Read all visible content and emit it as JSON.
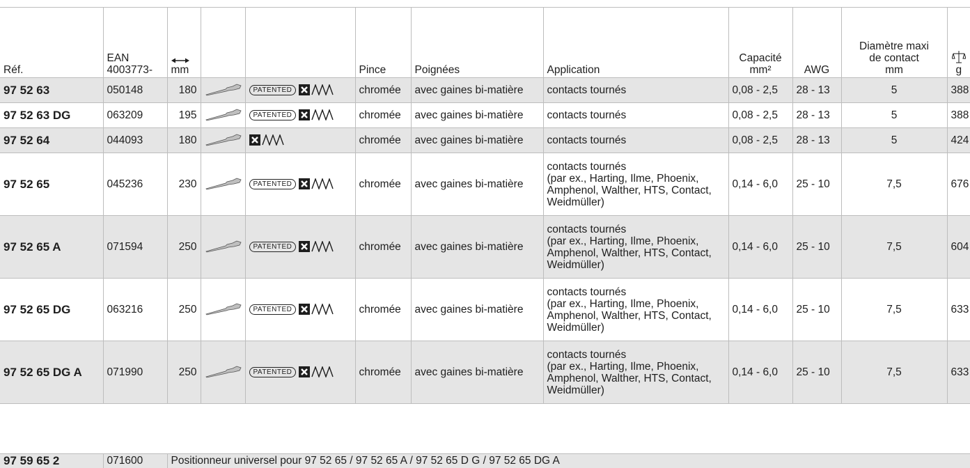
{
  "header": {
    "ref": "Réf.",
    "ean_line1": "EAN",
    "ean_line2": "4003773-",
    "length_unit": "mm",
    "pince": "Pince",
    "poignees": "Poignées",
    "application": "Application",
    "capacite_line1": "Capacité",
    "capacite_line2": "mm²",
    "awg": "AWG",
    "diam_line1": "Diamètre maxi",
    "diam_line2": "de contact",
    "diam_line3": "mm",
    "weight_unit": "g",
    "length_icon": "double-arrow-icon",
    "weight_icon": "scale-icon"
  },
  "patented_label": "PATENTED",
  "rows": [
    {
      "ref": "97 52 63",
      "ean": "050148",
      "length": "180",
      "patented": true,
      "pince": "chromée",
      "poignees": "avec gaines bi-matière",
      "app": "contacts tournés",
      "app_detail": "",
      "capacite": "0,08 - 2,5",
      "awg": "28 - 13",
      "diam": "5",
      "weight": "388"
    },
    {
      "ref": "97 52 63 DG",
      "ean": "063209",
      "length": "195",
      "patented": true,
      "pince": "chromée",
      "poignees": "avec gaines bi-matière",
      "app": "contacts tournés",
      "app_detail": "",
      "capacite": "0,08 - 2,5",
      "awg": "28 - 13",
      "diam": "5",
      "weight": "388"
    },
    {
      "ref": "97 52 64",
      "ean": "044093",
      "length": "180",
      "patented": false,
      "pince": "chromée",
      "poignees": "avec gaines bi-matière",
      "app": "contacts tournés",
      "app_detail": "",
      "capacite": "0,08 - 2,5",
      "awg": "28 - 13",
      "diam": "5",
      "weight": "424"
    },
    {
      "ref": "97 52 65",
      "ean": "045236",
      "length": "230",
      "patented": true,
      "pince": "chromée",
      "poignees": "avec gaines bi-matière",
      "app": "contacts tournés",
      "app_detail": "(par ex., Harting, Ilme, Phoenix, Amphenol, Walther, HTS, Contact, Weidmüller)",
      "capacite": "0,14 - 6,0",
      "awg": "25 - 10",
      "diam": "7,5",
      "weight": "676"
    },
    {
      "ref": "97 52 65 A",
      "ean": "071594",
      "length": "250",
      "patented": true,
      "pince": "chromée",
      "poignees": "avec gaines bi-matière",
      "app": "contacts tournés",
      "app_detail": "(par ex., Harting, Ilme, Phoenix, Amphenol, Walther, HTS, Contact, Weidmüller)",
      "capacite": "0,14 - 6,0",
      "awg": "25 - 10",
      "diam": "7,5",
      "weight": "604"
    },
    {
      "ref": "97 52 65 DG",
      "ean": "063216",
      "length": "250",
      "patented": true,
      "pince": "chromée",
      "poignees": "avec gaines bi-matière",
      "app": "contacts tournés",
      "app_detail": "(par ex., Harting, Ilme, Phoenix, Amphenol, Walther, HTS, Contact, Weidmüller)",
      "capacite": "0,14 - 6,0",
      "awg": "25 - 10",
      "diam": "7,5",
      "weight": "633"
    },
    {
      "ref": "97 52 65 DG A",
      "ean": "071990",
      "length": "250",
      "patented": true,
      "pince": "chromée",
      "poignees": "avec gaines bi-matière",
      "app": "contacts tournés",
      "app_detail": "(par ex., Harting, Ilme, Phoenix, Amphenol, Walther, HTS, Contact, Weidmüller)",
      "capacite": "0,14 - 6,0",
      "awg": "25 - 10",
      "diam": "7,5",
      "weight": "633"
    }
  ],
  "footer": {
    "ref": "97 59 65 2",
    "ean": "071600",
    "description": "Positionneur universel pour 97 52 65 / 97 52 65 A / 97 52 65 D G / 97 52 65 DG A"
  },
  "colors": {
    "row_shade": "#e5e5e5",
    "border": "#bdbdbd"
  }
}
